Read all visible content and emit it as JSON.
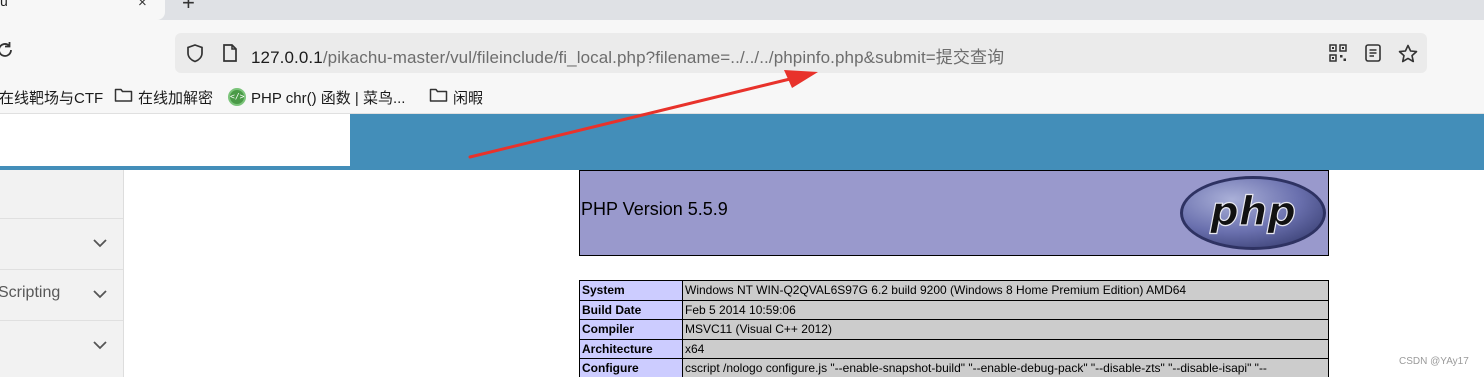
{
  "browser": {
    "tab": {
      "title": "u",
      "close_glyph": "×"
    },
    "new_tab_glyph": "+",
    "address": {
      "host": "127.0.0.1",
      "path": "/pikachu-master/vul/fileinclude/fi_local.php?filename=../../../phpinfo.php&submit=提交查询"
    },
    "bookmarks": [
      {
        "label": "在线靶场与CTF",
        "icon": "none"
      },
      {
        "label": "在线加解密",
        "icon": "folder-icon"
      },
      {
        "label": "PHP chr() 函数 | 菜鸟...",
        "icon": "site-favicon-icon"
      },
      {
        "label": "闲暇",
        "icon": "folder-icon"
      }
    ]
  },
  "sidebar": {
    "items": [
      {
        "label": ""
      },
      {
        "label": "Scripting"
      },
      {
        "label": ""
      }
    ]
  },
  "phpinfo": {
    "version": "PHP Version 5.5.9",
    "logo_text": "php",
    "rows": [
      {
        "key": "System",
        "value": "Windows NT WIN-Q2QVAL6S97G 6.2 build 9200 (Windows 8 Home Premium Edition) AMD64"
      },
      {
        "key": "Build Date",
        "value": "Feb 5 2014 10:59:06"
      },
      {
        "key": "Compiler",
        "value": "MSVC11 (Visual C++ 2012)"
      },
      {
        "key": "Architecture",
        "value": "x64"
      },
      {
        "key": "Configure",
        "value": "cscript /nologo configure.js \"--enable-snapshot-build\" \"--enable-debug-pack\" \"--disable-zts\" \"--disable-isapi\" \"--"
      }
    ]
  },
  "watermark": "CSDN @YAy17",
  "colors": {
    "header_band": "#438eb9",
    "php_header": "#9999cc",
    "php_key": "#ccccff",
    "php_value": "#cccccc",
    "arrow": "#e8322b"
  }
}
